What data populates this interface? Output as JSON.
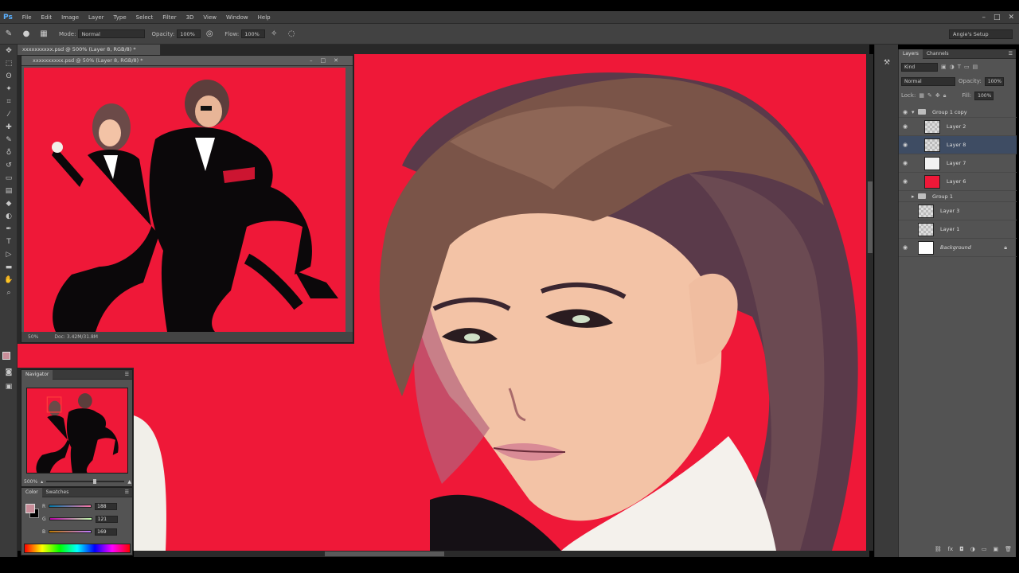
{
  "app": {
    "logo": "Ps",
    "menu": [
      "File",
      "Edit",
      "Image",
      "Layer",
      "Type",
      "Select",
      "Filter",
      "3D",
      "View",
      "Window",
      "Help"
    ],
    "window_controls": [
      "–",
      "□",
      "✕"
    ]
  },
  "options_bar": {
    "mode_label": "Mode:",
    "mode_value": "Normal",
    "opacity_label": "Opacity:",
    "opacity_value": "100%",
    "flow_label": "Flow:",
    "flow_value": "100%",
    "workspace": "Angie's Setup"
  },
  "document": {
    "tab_title": "xxxxxxxxxx.psd @ 500% (Layer 8, RGB/8) *",
    "float_title": "xxxxxxxxxx.psd @ 50% (Layer 8, RGB/8) *",
    "zoom": "50%",
    "doc_info": "Doc: 3.42M/31.8M"
  },
  "navigator": {
    "tabs": [
      "Navigator"
    ],
    "zoom": "500%"
  },
  "color_panel": {
    "tabs": [
      "Color",
      "Swatches"
    ],
    "rows": [
      {
        "label": "R",
        "value": "188"
      },
      {
        "label": "G",
        "value": "121"
      },
      {
        "label": "B",
        "value": "169"
      }
    ],
    "foreground": "#c98d99",
    "background": "#000000"
  },
  "layers_panel": {
    "tabs": [
      "Layers",
      "Channels"
    ],
    "kind": "Kind",
    "blend_mode": "Normal",
    "opacity_label": "Opacity:",
    "opacity_value": "100%",
    "lock_label": "Lock:",
    "fill_label": "Fill:",
    "fill_value": "100%",
    "layers": [
      {
        "name": "Group 1 copy",
        "type": "group",
        "visible": true
      },
      {
        "name": "Layer 2",
        "type": "transparent",
        "visible": true
      },
      {
        "name": "Layer 8",
        "type": "transparent",
        "visible": true,
        "selected": true
      },
      {
        "name": "Layer 7",
        "type": "ink",
        "visible": true
      },
      {
        "name": "Layer 6",
        "type": "red",
        "visible": true
      },
      {
        "name": "Group 1",
        "type": "group",
        "visible": false
      },
      {
        "name": "Layer 3",
        "type": "transparent",
        "visible": false
      },
      {
        "name": "Layer 1",
        "type": "transparent",
        "visible": false
      },
      {
        "name": "Background",
        "type": "white",
        "visible": true,
        "locked": true
      }
    ]
  },
  "colors": {
    "canvas_red": "#ef1838",
    "panel_gray": "#535353",
    "selected_layer": "#3e4c63"
  }
}
